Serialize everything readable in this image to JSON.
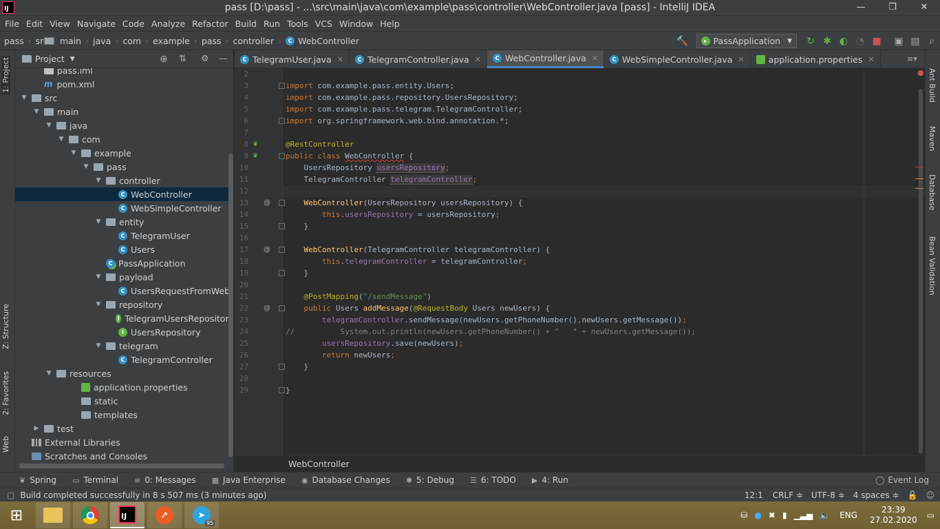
{
  "window": {
    "title": "pass [D:\\pass] - ...\\src\\main\\java\\com\\example\\pass\\controller\\WebController.java [pass] - IntelliJ IDEA",
    "logo": "IJ"
  },
  "menu": [
    "File",
    "Edit",
    "View",
    "Navigate",
    "Code",
    "Analyze",
    "Refactor",
    "Build",
    "Run",
    "Tools",
    "VCS",
    "Window",
    "Help"
  ],
  "breadcrumbs": [
    "pass",
    "src",
    "main",
    "java",
    "com",
    "example",
    "pass",
    "controller",
    "WebController"
  ],
  "run_config": "PassApplication",
  "left_tabs": {
    "project": "1: Project",
    "structure": "Z: Structure",
    "favorites": "2: Favorites",
    "web": "Web"
  },
  "right_tabs": {
    "ant": "Ant Build",
    "maven": "Maven",
    "database": "Database",
    "bean": "Bean Validation"
  },
  "project_panel": {
    "title": "Project"
  },
  "tree": [
    {
      "label": "pass.iml",
      "level": 1,
      "type": "file",
      "arrow": ""
    },
    {
      "label": "pom.xml",
      "level": 1,
      "type": "maven",
      "arrow": ""
    },
    {
      "label": "src",
      "level": 0,
      "type": "folder",
      "arrow": "▼"
    },
    {
      "label": "main",
      "level": 1,
      "type": "folder",
      "arrow": "▼"
    },
    {
      "label": "java",
      "level": 2,
      "type": "folder",
      "arrow": "▼"
    },
    {
      "label": "com",
      "level": 3,
      "type": "folder",
      "arrow": "▼"
    },
    {
      "label": "example",
      "level": 4,
      "type": "folder",
      "arrow": "▼"
    },
    {
      "label": "pass",
      "level": 5,
      "type": "folder",
      "arrow": "▼"
    },
    {
      "label": "controller",
      "level": 6,
      "type": "folder",
      "arrow": "▼"
    },
    {
      "label": "WebController",
      "level": 7,
      "type": "class",
      "arrow": "",
      "selected": true
    },
    {
      "label": "WebSimpleController",
      "level": 7,
      "type": "class",
      "arrow": ""
    },
    {
      "label": "entity",
      "level": 6,
      "type": "folder",
      "arrow": "▼"
    },
    {
      "label": "TelegramUser",
      "level": 7,
      "type": "class",
      "arrow": ""
    },
    {
      "label": "Users",
      "level": 7,
      "type": "class",
      "arrow": ""
    },
    {
      "label": "PassApplication",
      "level": 6,
      "type": "springclass",
      "arrow": ""
    },
    {
      "label": "payload",
      "level": 6,
      "type": "folder",
      "arrow": "▼"
    },
    {
      "label": "UsersRequestFromWeb",
      "level": 7,
      "type": "class",
      "arrow": ""
    },
    {
      "label": "repository",
      "level": 6,
      "type": "folder",
      "arrow": "▼"
    },
    {
      "label": "TelegramUsersRepository",
      "level": 7,
      "type": "interface",
      "arrow": ""
    },
    {
      "label": "UsersRepository",
      "level": 7,
      "type": "interface",
      "arrow": ""
    },
    {
      "label": "telegram",
      "level": 6,
      "type": "folder",
      "arrow": "▼"
    },
    {
      "label": "TelegramController",
      "level": 7,
      "type": "class",
      "arrow": ""
    },
    {
      "label": "resources",
      "level": 2,
      "type": "folder",
      "arrow": "▼"
    },
    {
      "label": "application.properties",
      "level": 4,
      "type": "props",
      "arrow": ""
    },
    {
      "label": "static",
      "level": 4,
      "type": "folder",
      "arrow": ""
    },
    {
      "label": "templates",
      "level": 4,
      "type": "folder",
      "arrow": ""
    },
    {
      "label": "test",
      "level": 1,
      "type": "folder",
      "arrow": "▶"
    },
    {
      "label": "External Libraries",
      "level": 0,
      "type": "lib",
      "arrow": ""
    },
    {
      "label": "Scratches and Consoles",
      "level": 0,
      "type": "scratch",
      "arrow": ""
    }
  ],
  "tabs": [
    {
      "label": "TelegramUser.java",
      "type": "class"
    },
    {
      "label": "TelegramController.java",
      "type": "class"
    },
    {
      "label": "WebController.java",
      "type": "class",
      "active": true
    },
    {
      "label": "WebSimpleController.java",
      "type": "class"
    },
    {
      "label": "application.properties",
      "type": "props"
    }
  ],
  "code_lines": [
    {
      "n": "2",
      "html": ""
    },
    {
      "n": "3",
      "html": "<span class='k'>import</span> com.example.pass.entity.Users;"
    },
    {
      "n": "4",
      "html": "<span class='k'>import</span> com.example.pass.repository.UsersRepository;"
    },
    {
      "n": "5",
      "html": "<span class='k'>import</span> com.example.pass.telegram.TelegramController;"
    },
    {
      "n": "6",
      "html": "<span class='k'>import</span> org.springframework.web.bind.annotation.*;"
    },
    {
      "n": "7",
      "html": ""
    },
    {
      "n": "8",
      "html": "<span class='a'>@RestController</span>"
    },
    {
      "n": "9",
      "html": "<span class='k'>public class</span> <span class='wavy'>WebController</span> {"
    },
    {
      "n": "10",
      "html": "    UsersRepository <span class='f hl'>usersRepository</span><span class='k'>;</span>"
    },
    {
      "n": "11",
      "html": "    TelegramController <span class='f hl'>telegramController</span><span class='k'>;</span>"
    },
    {
      "n": "12",
      "html": ""
    },
    {
      "n": "13",
      "html": "    <span class='m'>WebController</span>(UsersRepository usersRepository) {"
    },
    {
      "n": "14",
      "html": "        <span class='k'>this</span>.<span class='f'>usersRepository</span> = usersRepository<span class='k'>;</span>"
    },
    {
      "n": "15",
      "html": "    }"
    },
    {
      "n": "16",
      "html": ""
    },
    {
      "n": "17",
      "html": "    <span class='m'>WebController</span>(TelegramController telegramController) {"
    },
    {
      "n": "18",
      "html": "        <span class='k'>this</span>.<span class='f'>telegramController</span> = telegramController<span class='k'>;</span>"
    },
    {
      "n": "19",
      "html": "    }"
    },
    {
      "n": "20",
      "html": ""
    },
    {
      "n": "21",
      "html": "    <span class='a'>@PostMapping</span>(<span class='s'>\"/sendMessage\"</span>)"
    },
    {
      "n": "22",
      "html": "    <span class='k'>public</span> Users <span class='m'>addMessage</span>(<span class='a'>@RequestBody</span> Users newUsers) {"
    },
    {
      "n": "23",
      "html": "        <span class='f'>telegramController</span>.sendMessage(newUsers.getPhoneNumber()<span class='k'>,</span>newUsers.getMessage())<span class='k'>;</span>"
    },
    {
      "n": "24",
      "html": "<span class='c'>//          System.out.println(newUsers.getPhoneNumber() + \"   \" + newUsers.getMessage());</span>"
    },
    {
      "n": "25",
      "html": "        <span class='f'>usersRepository</span>.save(newUsers)<span class='k'>;</span>"
    },
    {
      "n": "26",
      "html": "        <span class='k'>return</span> newUsers<span class='k'>;</span>"
    },
    {
      "n": "27",
      "html": "    }"
    },
    {
      "n": "28",
      "html": ""
    },
    {
      "n": "29",
      "html": "}"
    }
  ],
  "editor_breadcrumb": "WebController",
  "tool_windows": [
    {
      "label": "Spring",
      "icon": "leaf-icon"
    },
    {
      "label": "Terminal",
      "icon": "terminal-icon"
    },
    {
      "label": "0: Messages",
      "icon": "messages-icon"
    },
    {
      "label": "Java Enterprise",
      "icon": "enterprise-icon"
    },
    {
      "label": "Database Changes",
      "icon": "database-icon"
    },
    {
      "label": "5: Debug",
      "icon": "bug-icon"
    },
    {
      "label": "6: TODO",
      "icon": "list-icon"
    },
    {
      "label": "4: Run",
      "icon": "play-icon"
    }
  ],
  "event_log": "Event Log",
  "status": {
    "message": "Build completed successfully in 8 s 507 ms (3 minutes ago)",
    "position": "12:1",
    "line_sep": "CRLF ≑",
    "encoding": "UTF-8 ≑",
    "indent": "4 spaces ≑"
  },
  "taskbar": {
    "lang": "ENG",
    "time": "23:39",
    "date": "27.02.2020",
    "telegram_badge": "95"
  }
}
